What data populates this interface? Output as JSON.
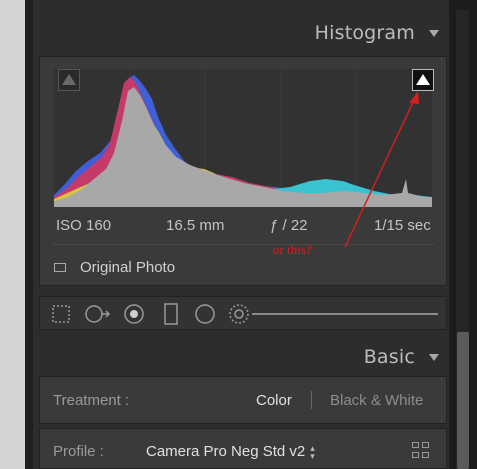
{
  "histogram": {
    "title": "Histogram",
    "exif": {
      "iso": "ISO 160",
      "focal_length": "16.5 mm",
      "aperture": "ƒ / 22",
      "shutter": "1/15 sec"
    },
    "original_photo_label": "Original Photo"
  },
  "annotation": {
    "note": "or this?",
    "color": "#d21f1f"
  },
  "basic": {
    "title": "Basic",
    "treatment": {
      "label": "Treatment :",
      "color_option": "Color",
      "bw_option": "Black & White"
    },
    "profile": {
      "label": "Profile :",
      "value": "Camera Pro Neg Std v2"
    }
  },
  "icons": [
    "shadow-clipping-icon",
    "highlight-clipping-icon",
    "crop-overlay-icon",
    "spot-removal-icon",
    "red-eye-icon",
    "graduated-filter-icon",
    "radial-filter-icon",
    "adjustment-brush-icon",
    "profile-browser-icon"
  ]
}
